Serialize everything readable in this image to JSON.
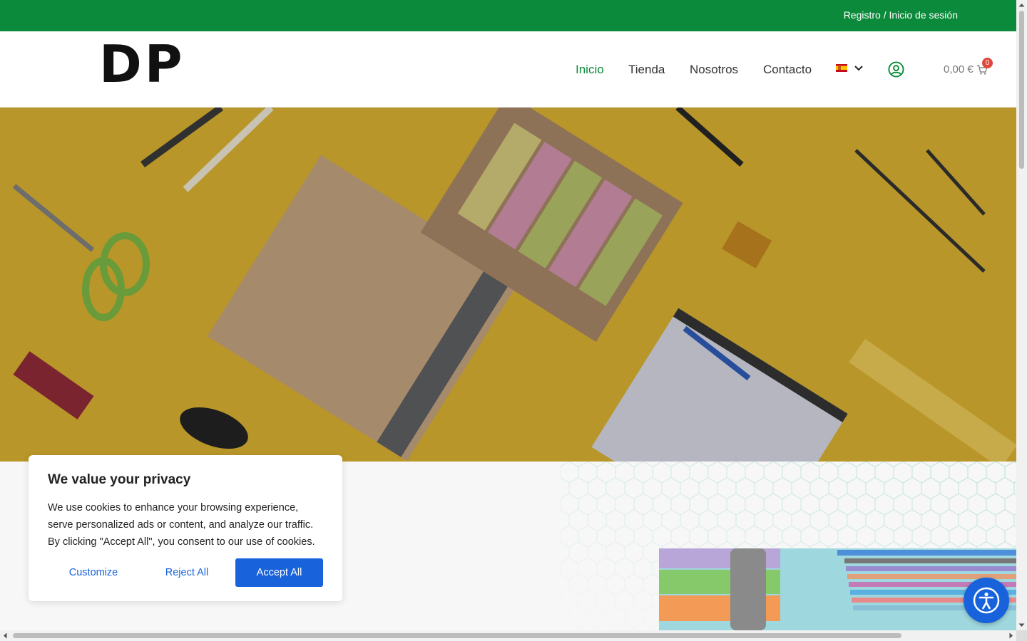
{
  "topbar": {
    "auth_link": "Registro / Inicio de sesión"
  },
  "header": {
    "logo": "DP",
    "nav": [
      "Inicio",
      "Tienda",
      "Nosotros",
      "Contacto"
    ],
    "active_nav": "Inicio",
    "language_flag": "flag-es-icon",
    "cart": {
      "total": "0,00 €",
      "count": "0"
    }
  },
  "cookie": {
    "title": "We value your privacy",
    "text": "We use cookies to enhance your browsing experience, serve personalized ads or content, and analyze our traffic. By clicking \"Accept All\", you consent to our use of cookies.",
    "customize": "Customize",
    "reject": "Reject All",
    "accept": "Accept All"
  },
  "colors": {
    "brand_green": "#0c8a3b",
    "cookie_blue": "#1863dc",
    "hero_yellow": "#b89629"
  }
}
